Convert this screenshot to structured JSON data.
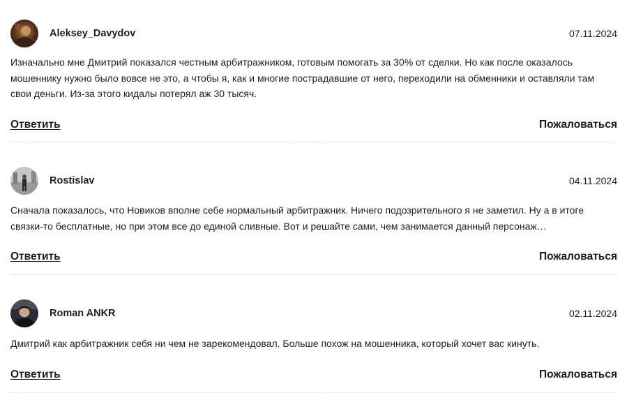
{
  "comments": [
    {
      "author": "Aleksey_Davydov",
      "date": "07.11.2024",
      "text": "Изначально мне Дмитрий показался честным арбитражником, готовым помогать за 30% от сделки. Но как после оказалось мошеннику нужно было вовсе не это, а чтобы я, как и многие пострадавшие от него, переходили на обменники и оставляли там свои деньги. Из-за этого кидалы потерял аж 30 тысяч.",
      "reply_label": "Ответить",
      "report_label": "Пожаловаться"
    },
    {
      "author": "Rostislav",
      "date": "04.11.2024",
      "text": "Сначала показалось, что Новиков вполне себе нормальный арбитражник. Ничего подозрительного я не заметил. Ну а в итоге связки-то бесплатные, но при этом все до единой сливные. Вот и решайте сами, чем занимается данный персонаж…",
      "reply_label": "Ответить",
      "report_label": "Пожаловаться"
    },
    {
      "author": "Roman ANKR",
      "date": "02.11.2024",
      "text": "Дмитрий как арбитражник себя ни чем не зарекомендовал. Больше похож на мошенника, который хочет вас кинуть.",
      "reply_label": "Ответить",
      "report_label": "Пожаловаться"
    }
  ]
}
